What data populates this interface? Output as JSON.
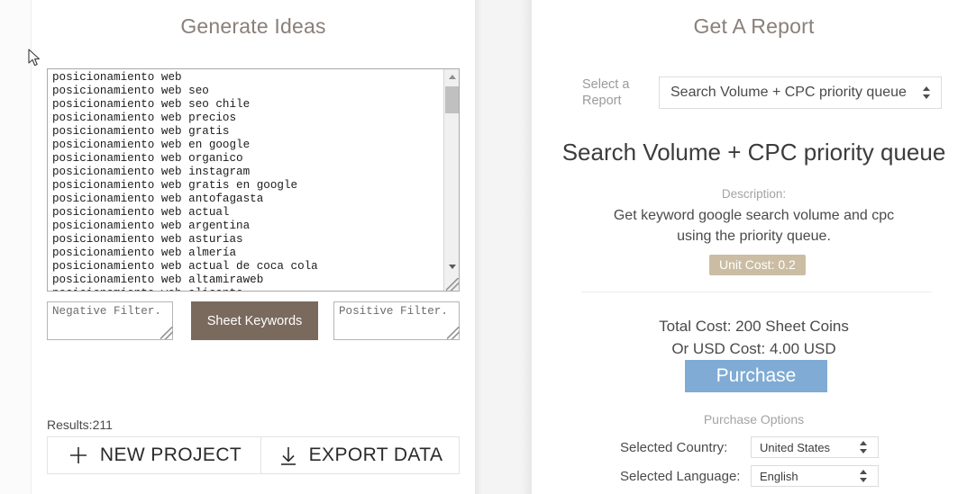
{
  "left_panel": {
    "title": "Generate Ideas",
    "keywords_textarea": {
      "value": "posicionamiento web\nposicionamiento web seo\nposicionamiento web seo chile\nposicionamiento web precios\nposicionamiento web gratis\nposicionamiento web en google\nposicionamiento web organico\nposicionamiento web instagram\nposicionamiento web gratis en google\nposicionamiento web antofagasta\nposicionamiento web actual\nposicionamiento web argentina\nposicionamiento web asturias\nposicionamiento web almería\nposicionamiento web actual de coca cola\nposicionamiento web altamiraweb\nposicionamiento web alicante"
    },
    "negative_filter_placeholder": "Negative Filter.",
    "negative_filter_value": "",
    "positive_filter_placeholder": "Positive Filter.",
    "positive_filter_value": "",
    "sheet_keywords_label": "Sheet Keywords",
    "results_label": "Results:211",
    "new_project_label": "NEW PROJECT",
    "export_data_label": "EXPORT DATA"
  },
  "right_panel": {
    "title": "Get A Report",
    "select_report_label": "Select a Report",
    "selected_report": "Search Volume + CPC priority queue",
    "report_name": "Search Volume + CPC priority queue",
    "description_label": "Description:",
    "description_text": "Get keyword google search volume and cpc using the priority queue.",
    "unit_cost": "Unit Cost: 0.2",
    "total_cost": "Total Cost: 200 Sheet Coins",
    "usd_cost": "Or USD Cost: 4.00 USD",
    "purchase_label": "Purchase",
    "purchase_options_title": "Purchase Options",
    "country_label": "Selected Country:",
    "selected_country": "United States",
    "language_label": "Selected Language:",
    "selected_language": "English"
  },
  "colors": {
    "title_brown": "#8a7f79",
    "sheet_button_brown": "#7a695d",
    "unit_cost_tan": "#cbbda4",
    "purchase_blue": "#7fabd4",
    "body_text": "#4a4a4a"
  }
}
